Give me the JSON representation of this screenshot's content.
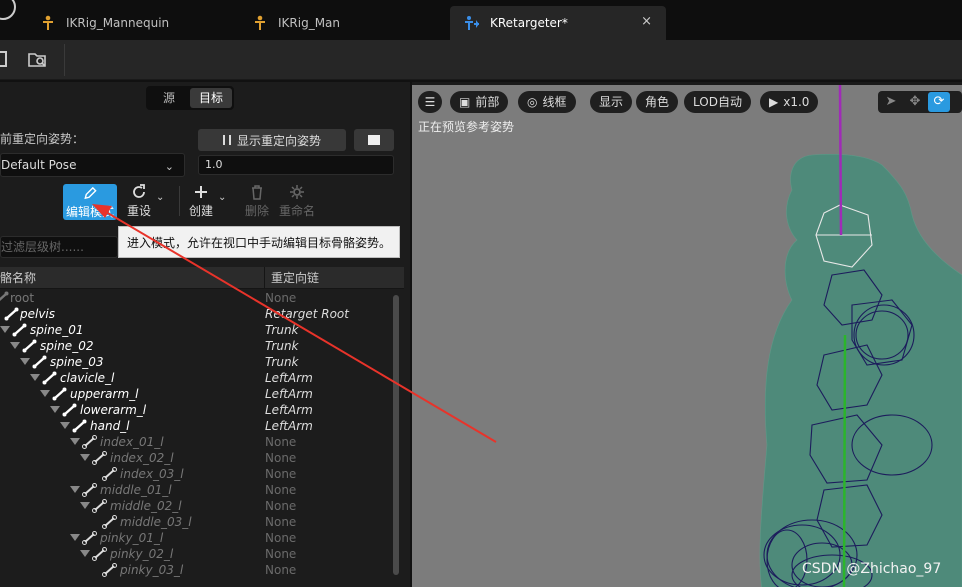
{
  "tabs": [
    {
      "label": "IKRig_Mannequin"
    },
    {
      "label": "IKRig_Man"
    },
    {
      "label": "KRetargeter*",
      "close": "×"
    }
  ],
  "segment": {
    "source": "源",
    "target": "目标"
  },
  "pose": {
    "label": "前重定向姿势：",
    "show_button": "显示重定向姿势",
    "selected": "Default Pose",
    "value": "1.0"
  },
  "actions": {
    "edit_mode": "编辑模式",
    "reset": "重设",
    "create": "创建",
    "delete": "删除",
    "rename": "重命名"
  },
  "search": {
    "placeholder": "过滤层级树......"
  },
  "tooltip": "进入模式，允许在视口中手动编辑目标骨骼姿势。",
  "table": {
    "col_name": "骼名称",
    "col_chain": "重定向链",
    "rows": [
      {
        "name": "root",
        "chain": "None"
      },
      {
        "name": "pelvis",
        "chain": "Retarget Root"
      },
      {
        "name": "spine_01",
        "chain": "Trunk"
      },
      {
        "name": "spine_02",
        "chain": "Trunk"
      },
      {
        "name": "spine_03",
        "chain": "Trunk"
      },
      {
        "name": "clavicle_l",
        "chain": "LeftArm"
      },
      {
        "name": "upperarm_l",
        "chain": "LeftArm"
      },
      {
        "name": "lowerarm_l",
        "chain": "LeftArm"
      },
      {
        "name": "hand_l",
        "chain": "LeftArm"
      },
      {
        "name": "index_01_l",
        "chain": "None"
      },
      {
        "name": "index_02_l",
        "chain": "None"
      },
      {
        "name": "index_03_l",
        "chain": "None"
      },
      {
        "name": "middle_01_l",
        "chain": "None"
      },
      {
        "name": "middle_02_l",
        "chain": "None"
      },
      {
        "name": "middle_03_l",
        "chain": "None"
      },
      {
        "name": "pinky_01_l",
        "chain": "None"
      },
      {
        "name": "pinky_02_l",
        "chain": "None"
      },
      {
        "name": "pinky_03_l",
        "chain": "None"
      }
    ]
  },
  "viewport": {
    "buttons": [
      {
        "label": "前部"
      },
      {
        "label": "线框"
      },
      {
        "label": "显示"
      },
      {
        "label": "角色"
      },
      {
        "label": "LOD自动"
      },
      {
        "label": "x1.0"
      }
    ],
    "status": "正在预览参考姿势"
  },
  "watermark": "CSDN @Zhichao_97",
  "colors": {
    "accent": "#2a9ae0",
    "arrow": "#e8332a",
    "mesh": "#4e8a7a",
    "wire": "#1a1a5a"
  }
}
